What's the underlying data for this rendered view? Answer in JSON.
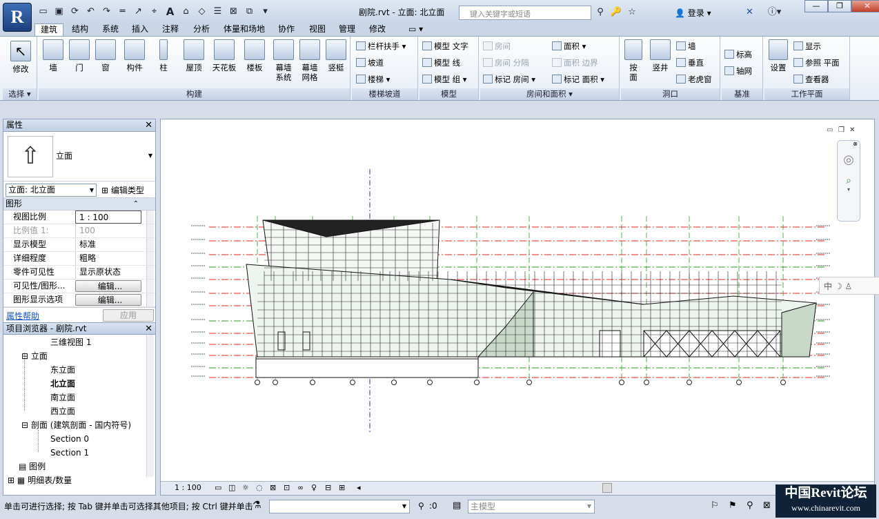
{
  "app": {
    "logo": "R",
    "document_title": "剧院.rvt - 立面: 北立面",
    "search_placeholder": "键入关键字或短语",
    "login": "登录"
  },
  "quick_access": [
    "open-icon",
    "save-icon",
    "sync-icon",
    "undo-icon",
    "redo-icon",
    "measure-icon",
    "dimension-icon",
    "tag-icon",
    "text-icon",
    "3d-view-icon",
    "section-icon",
    "thin-lines-icon",
    "close-hidden-icon",
    "switch-windows-icon",
    "customize-icon"
  ],
  "tabs": [
    "建筑",
    "结构",
    "系统",
    "插入",
    "注释",
    "分析",
    "体量和场地",
    "协作",
    "视图",
    "管理",
    "修改"
  ],
  "ribbon": {
    "select": {
      "modify": "修改",
      "label": "选择"
    },
    "build": {
      "label": "构建",
      "buttons": [
        "墙",
        "门",
        "窗",
        "构件",
        "柱",
        "屋顶",
        "天花板",
        "楼板",
        "幕墙\n系统",
        "幕墙\n网格",
        "竖梃"
      ]
    },
    "circulation": {
      "label": "楼梯坡道",
      "items": [
        "栏杆扶手",
        "坡道",
        "楼梯"
      ]
    },
    "model": {
      "label": "模型",
      "items": [
        "模型 文字",
        "模型 线",
        "模型 组"
      ]
    },
    "room_area": {
      "label": "房间和面积",
      "items": [
        "房间",
        "房间 分隔",
        "标记 房间",
        "面积",
        "面积 边界",
        "标记 面积"
      ]
    },
    "opening": {
      "label": "洞口",
      "big": [
        "按\n面",
        "竖井"
      ],
      "items": [
        "墙",
        "垂直",
        "老虎窗"
      ]
    },
    "datum": {
      "label": "基准",
      "items": [
        "标高",
        "轴网"
      ]
    },
    "workplane": {
      "label": "工作平面",
      "big": "设置",
      "items": [
        "显示",
        "参照 平面",
        "查看器"
      ]
    }
  },
  "properties": {
    "title": "属性",
    "type_name": "立面",
    "instance_selector": "立面: 北立面",
    "edit_type": "编辑类型",
    "group": "图形",
    "rows": [
      {
        "key": "视图比例",
        "value": "1 : 100"
      },
      {
        "key": "比例值 1:",
        "value": "100"
      },
      {
        "key": "显示模型",
        "value": "标准"
      },
      {
        "key": "详细程度",
        "value": "粗略"
      },
      {
        "key": "零件可见性",
        "value": "显示原状态"
      },
      {
        "key": "可见性/图形...",
        "value": "编辑..."
      },
      {
        "key": "图形显示选项",
        "value": "编辑..."
      }
    ],
    "help": "属性帮助",
    "apply": "应用"
  },
  "browser": {
    "title": "项目浏览器 - 剧院.rvt",
    "nodes": [
      "三维视图 1",
      "立面",
      "东立面",
      "北立面",
      "南立面",
      "西立面",
      "剖面 (建筑剖面 - 国内符号)",
      "Section 0",
      "Section 1",
      "图例",
      "明细表/数量"
    ]
  },
  "view_control": {
    "scale": "1 : 100"
  },
  "status": {
    "hint": "单击可进行选择; 按 Tab 键并单击可选择其他项目; 按 Ctrl 键并单击",
    "filter_count": ":0",
    "model": "主模型"
  },
  "ime": {
    "label": "中"
  },
  "watermark": {
    "title": "中国Revit论坛",
    "url": "www.chinarevit.com"
  },
  "colors": {
    "ribbon_blue": "#c9d6e8",
    "level_line": "#e02020",
    "grid_line": "#2a9a2a",
    "section_line": "#2030c0"
  }
}
